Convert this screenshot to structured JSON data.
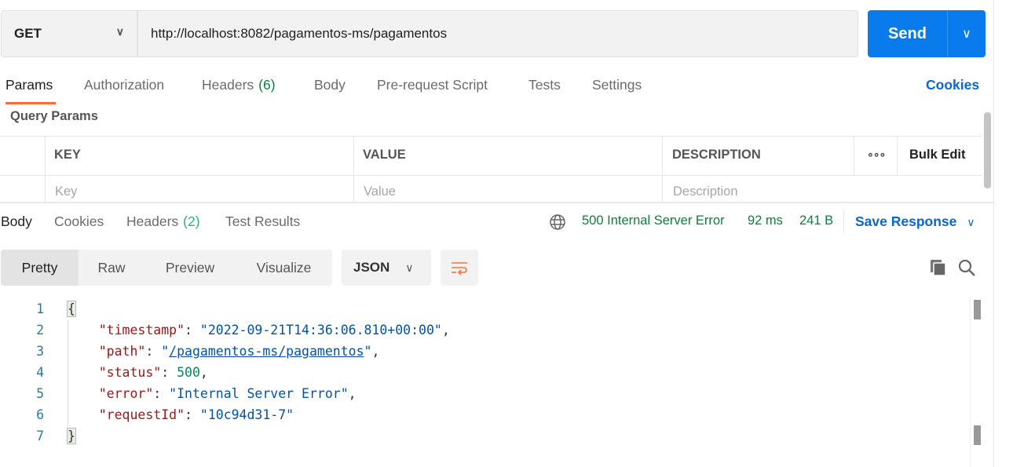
{
  "request": {
    "method": "GET",
    "url": "http://localhost:8082/pagamentos-ms/pagamentos",
    "send_label": "Send"
  },
  "request_tabs": [
    {
      "label": "Params",
      "active": true
    },
    {
      "label": "Authorization"
    },
    {
      "label": "Headers",
      "count": "(6)"
    },
    {
      "label": "Body"
    },
    {
      "label": "Pre-request Script"
    },
    {
      "label": "Tests"
    },
    {
      "label": "Settings"
    }
  ],
  "cookies_label": "Cookies",
  "query_params": {
    "title": "Query Params",
    "columns": [
      "KEY",
      "VALUE",
      "DESCRIPTION"
    ],
    "bulk_edit": "Bulk Edit",
    "placeholders": [
      "Key",
      "Value",
      "Description"
    ]
  },
  "response_tabs": [
    {
      "label": "Body",
      "active": true
    },
    {
      "label": "Cookies"
    },
    {
      "label": "Headers",
      "count": "(2)"
    },
    {
      "label": "Test Results"
    }
  ],
  "status": {
    "code": "500 Internal Server Error",
    "time": "92 ms",
    "size": "241 B",
    "save_label": "Save Response"
  },
  "view_modes": [
    "Pretty",
    "Raw",
    "Preview",
    "Visualize"
  ],
  "format": "JSON",
  "colors": {
    "accent": "#097BED",
    "active_tab": "#FF6C37",
    "status": "#0A7F3F"
  },
  "body_lines": [
    [
      [
        "p",
        "{"
      ]
    ],
    [
      [
        "k",
        "    \"timestamp\""
      ],
      [
        "p",
        ": "
      ],
      [
        "s",
        "\"2022-09-21T14:36:06.810+00:00\""
      ],
      [
        "p",
        ","
      ]
    ],
    [
      [
        "k",
        "    \"path\""
      ],
      [
        "p",
        ": "
      ],
      [
        "s",
        "\""
      ],
      [
        "link",
        "/pagamentos-ms/pagamentos"
      ],
      [
        "s",
        "\""
      ],
      [
        "p",
        ","
      ]
    ],
    [
      [
        "k",
        "    \"status\""
      ],
      [
        "p",
        ": "
      ],
      [
        "n",
        "500"
      ],
      [
        "p",
        ","
      ]
    ],
    [
      [
        "k",
        "    \"error\""
      ],
      [
        "p",
        ": "
      ],
      [
        "s",
        "\"Internal Server Error\""
      ],
      [
        "p",
        ","
      ]
    ],
    [
      [
        "k",
        "    \"requestId\""
      ],
      [
        "p",
        ": "
      ],
      [
        "s",
        "\"10c94d31-7\""
      ]
    ],
    [
      [
        "p",
        "}"
      ]
    ]
  ]
}
